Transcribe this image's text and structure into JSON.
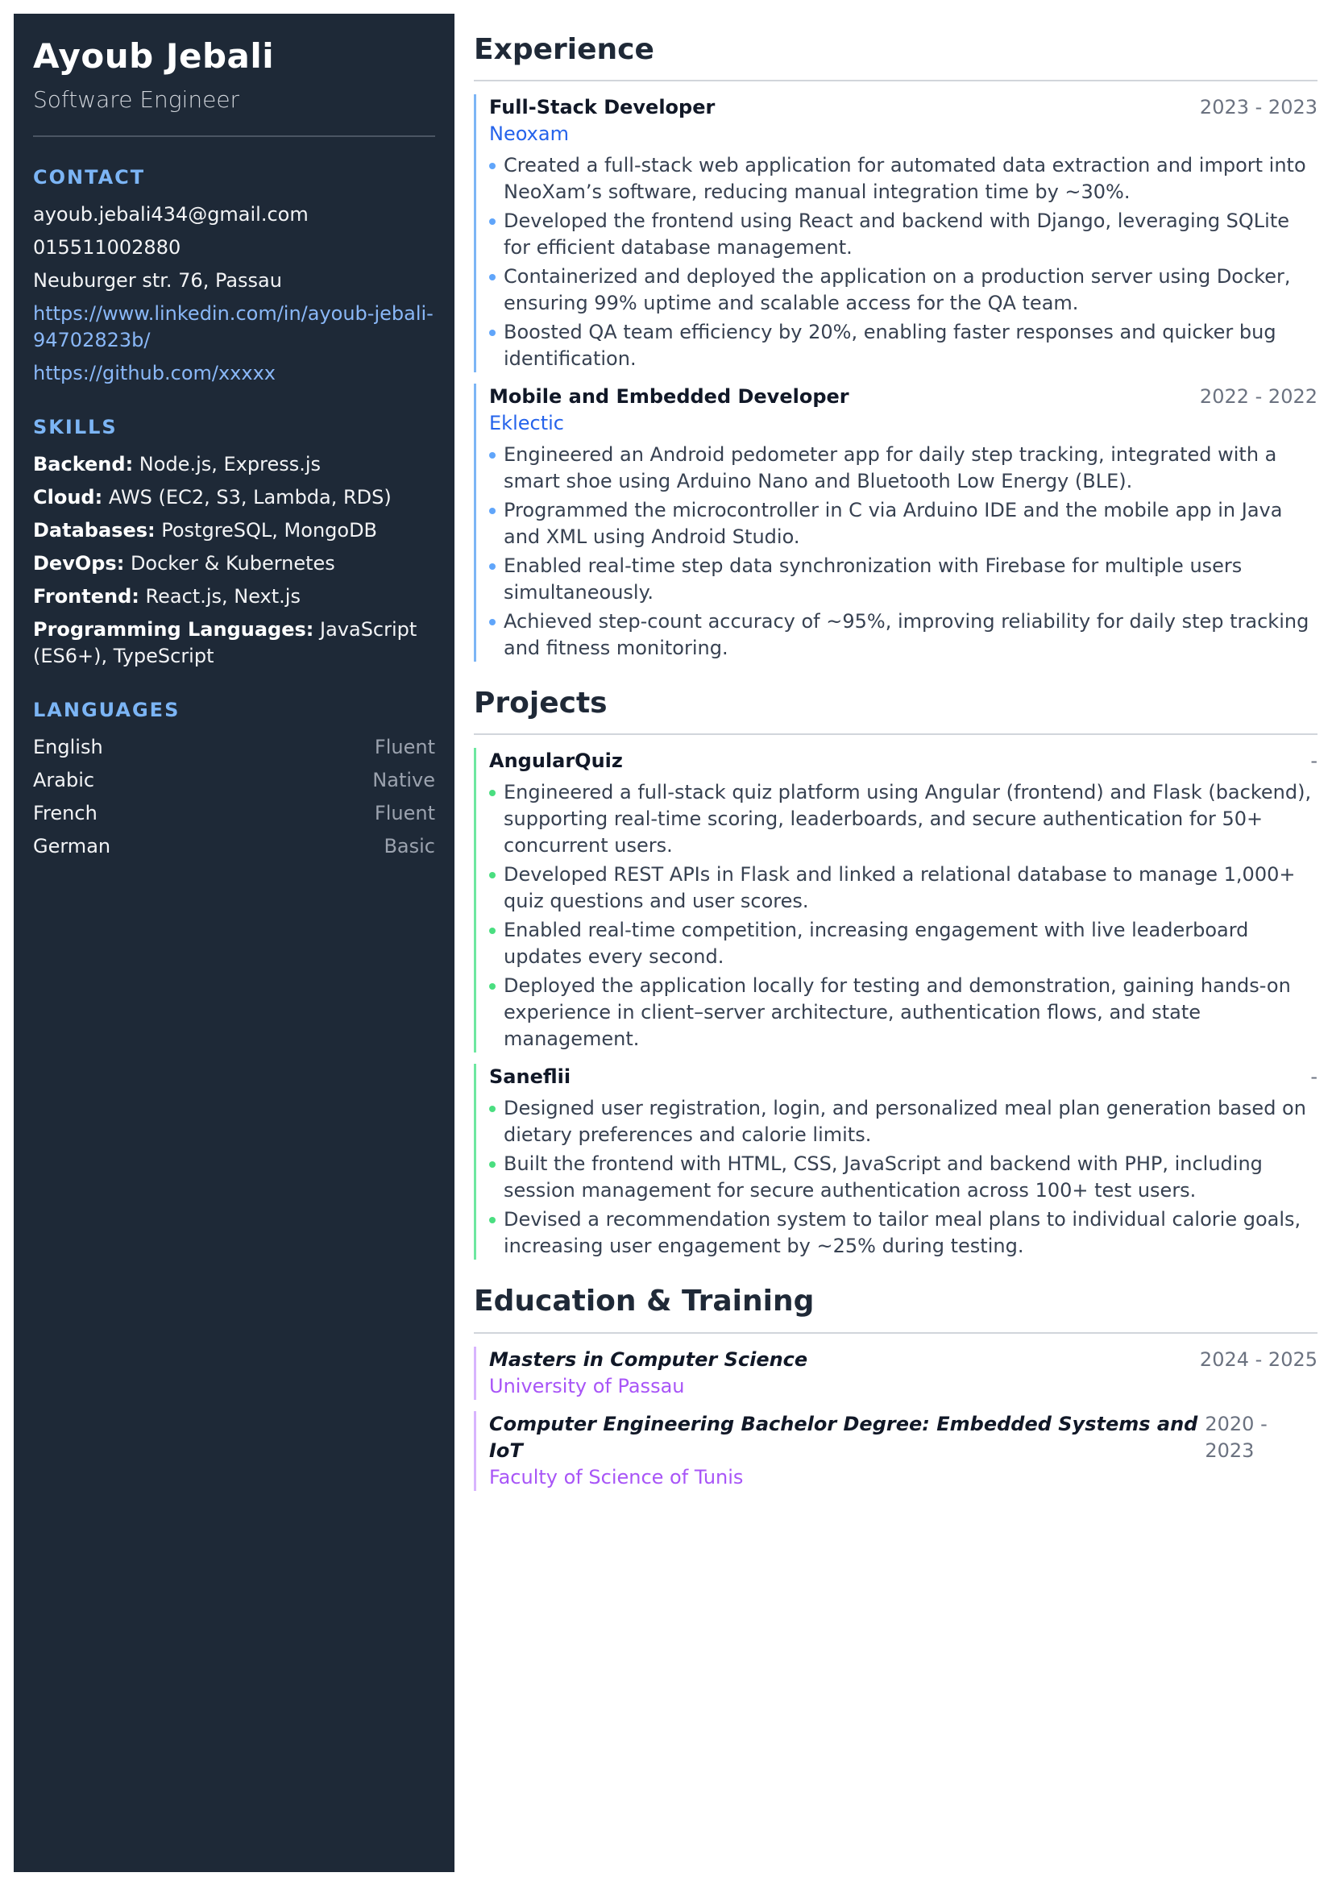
{
  "profile": {
    "name": "Ayoub Jebali",
    "title": "Software Engineer"
  },
  "contact": {
    "heading": "CONTACT",
    "email": "ayoub.jebali434@gmail.com",
    "phone": "015511002880",
    "address": "Neuburger str. 76, Passau",
    "linkedin": "https://www.linkedin.com/in/ayoub-jebali-94702823b/",
    "github": "https://github.com/xxxxx"
  },
  "skills": {
    "heading": "SKILLS",
    "items": [
      {
        "key": "Backend:",
        "value": " Node.js, Express.js"
      },
      {
        "key": "Cloud:",
        "value": " AWS (EC2, S3, Lambda, RDS)"
      },
      {
        "key": "Databases:",
        "value": " PostgreSQL, MongoDB"
      },
      {
        "key": "DevOps:",
        "value": " Docker & Kubernetes"
      },
      {
        "key": "Frontend:",
        "value": " React.js, Next.js"
      },
      {
        "key": "Programming Languages:",
        "value": " JavaScript (ES6+), TypeScript"
      }
    ]
  },
  "languages": {
    "heading": "LANGUAGES",
    "items": [
      {
        "name": "English",
        "level": "Fluent"
      },
      {
        "name": "Arabic",
        "level": "Native"
      },
      {
        "name": "French",
        "level": "Fluent"
      },
      {
        "name": "German",
        "level": "Basic"
      }
    ]
  },
  "experience": {
    "heading": "Experience",
    "items": [
      {
        "title": "Full-Stack Developer",
        "date": "2023 - 2023",
        "org": "Neoxam",
        "bullets": [
          "Created a full-stack web application for automated data extraction and import into NeoXam’s software, reducing manual integration time by ~30%.",
          "Developed the frontend using React and backend with Django, leveraging SQLite for efficient database management.",
          "Containerized and deployed the application on a production server using Docker, ensuring 99% uptime and scalable access for the QA team.",
          "Boosted QA team efficiency by 20%, enabling faster responses and quicker bug identification."
        ]
      },
      {
        "title": "Mobile and Embedded Developer",
        "date": "2022 - 2022",
        "org": "Eklectic",
        "bullets": [
          "Engineered an Android pedometer app for daily step tracking, integrated with a smart shoe using Arduino Nano and Bluetooth Low Energy (BLE).",
          "Programmed the microcontroller in C via Arduino IDE and the mobile app in Java and XML using Android Studio.",
          "Enabled real-time step data synchronization with Firebase for multiple users simultaneously.",
          "Achieved step-count accuracy of ~95%, improving reliability for daily step tracking and fitness monitoring."
        ]
      }
    ]
  },
  "projects": {
    "heading": "Projects",
    "items": [
      {
        "title": "AngularQuiz",
        "date": "-",
        "bullets": [
          "Engineered a full-stack quiz platform using Angular (frontend) and Flask (backend), supporting real-time scoring, leaderboards, and secure authentication for 50+ concurrent users.",
          "Developed REST APIs in Flask and linked a relational database to manage 1,000+ quiz questions and user scores.",
          "Enabled real-time competition, increasing engagement with live leaderboard updates every second.",
          "Deployed the application locally for testing and demonstration, gaining hands-on experience in client–server architecture, authentication flows, and state management."
        ]
      },
      {
        "title": "Saneflii",
        "date": "-",
        "bullets": [
          "Designed user registration, login, and personalized meal plan generation based on dietary preferences and calorie limits.",
          "Built the frontend with HTML, CSS, JavaScript and backend with PHP, including session management for secure authentication across 100+ test users.",
          "Devised a recommendation system to tailor meal plans to individual calorie goals, increasing user engagement by ~25% during testing."
        ]
      }
    ]
  },
  "education": {
    "heading": "Education & Training",
    "items": [
      {
        "title": "Masters in Computer Science",
        "date": "2024 - 2025",
        "org": "University of Passau"
      },
      {
        "title": "Computer Engineering Bachelor Degree: Embedded Systems and IoT",
        "date": "2020 - 2023",
        "org": "Faculty of Science of Tunis"
      }
    ]
  },
  "colors": {
    "sidebar_bg": "#1e2937",
    "accent_blue": "#7cb5f5",
    "accent_green": "#6ee7a0",
    "accent_purple": "#d8b4fe"
  }
}
